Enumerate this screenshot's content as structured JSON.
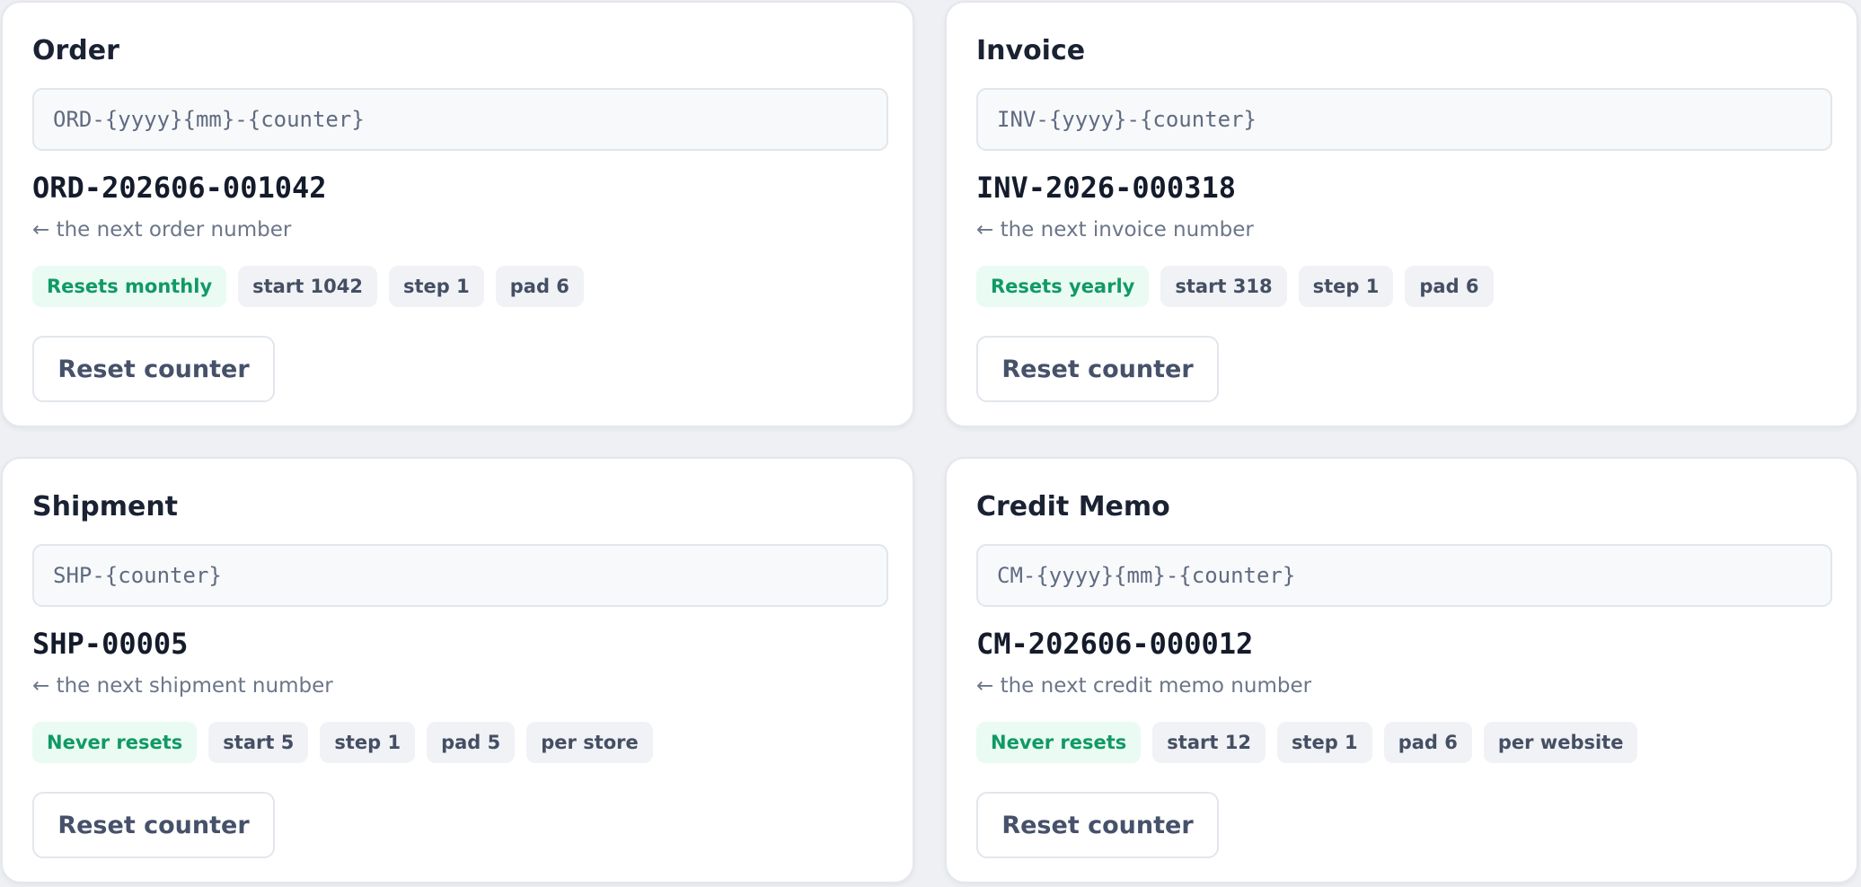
{
  "cards": [
    {
      "title": "Order",
      "pattern": "ORD-{yyyy}{mm}-{counter}",
      "next_value": "ORD-202606-001042",
      "hint": "← the next order number",
      "chips": [
        "Resets monthly",
        "start 1042",
        "step 1",
        "pad 6"
      ],
      "reset_label": "Reset counter"
    },
    {
      "title": "Invoice",
      "pattern": "INV-{yyyy}-{counter}",
      "next_value": "INV-2026-000318",
      "hint": "← the next invoice number",
      "chips": [
        "Resets yearly",
        "start 318",
        "step 1",
        "pad 6"
      ],
      "reset_label": "Reset counter"
    },
    {
      "title": "Shipment",
      "pattern": "SHP-{counter}",
      "next_value": "SHP-00005",
      "hint": "← the next shipment number",
      "chips": [
        "Never resets",
        "start 5",
        "step 1",
        "pad 5",
        "per store"
      ],
      "reset_label": "Reset counter"
    },
    {
      "title": "Credit Memo",
      "pattern": "CM-{yyyy}{mm}-{counter}",
      "next_value": "CM-202606-000012",
      "hint": "← the next credit memo number",
      "chips": [
        "Never resets",
        "start 12",
        "step 1",
        "pad 6",
        "per website"
      ],
      "reset_label": "Reset counter"
    }
  ],
  "colors": {
    "reset_chip_text": "#119966",
    "reset_chip_bg": "#e9fbf3",
    "chip_bg": "#f0f2f6",
    "page_bg": "#eef0f4"
  }
}
